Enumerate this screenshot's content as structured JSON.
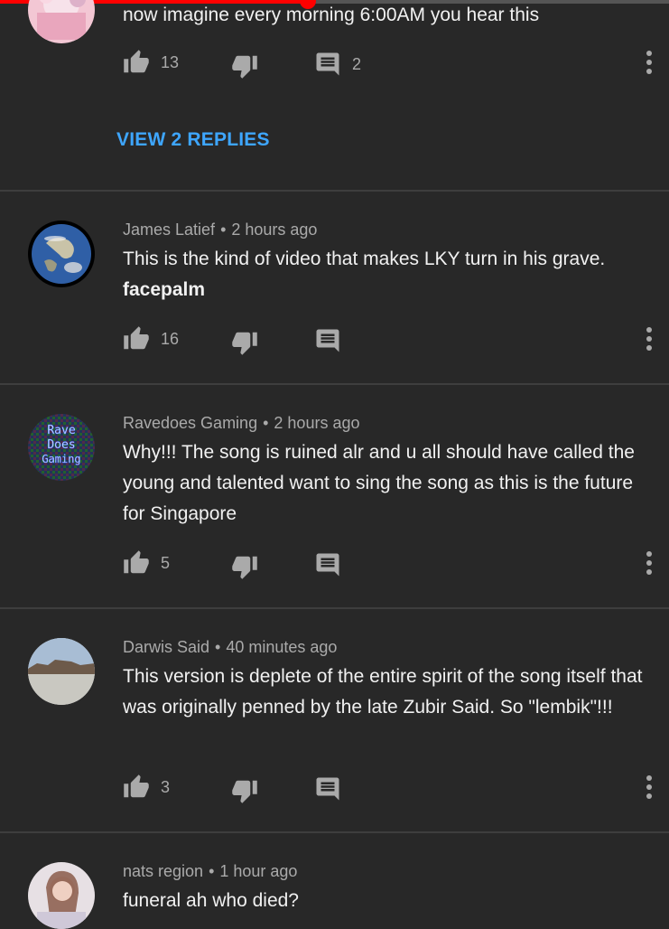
{
  "player": {
    "progress_percent": 46
  },
  "comments": [
    {
      "author": "",
      "time": "",
      "text": "now imagine every morning 6:00AM you hear this",
      "likes": "13",
      "replies_count": "2",
      "view_replies": "VIEW 2 REPLIES"
    },
    {
      "author": "James Latief",
      "time": "2 hours ago",
      "text": "This is the kind of video that makes LKY turn in his grave.",
      "bold": "facepalm",
      "likes": "16"
    },
    {
      "author": "Ravedoes Gaming",
      "time": "2 hours ago",
      "text": "Why!!! The song is ruined alr and u all should have called the young and talented want to sing the song as this is the future for Singapore",
      "likes": "5",
      "avatar_text": [
        "Rave",
        "Does",
        "Gaming"
      ]
    },
    {
      "author": "Darwis Said",
      "time": "40 minutes ago",
      "text": "This version is deplete of the entire spirit of the song itself that was originally penned by the late Zubir Said. So \"lembik\"!!!",
      "likes": "3"
    },
    {
      "author": "nats region",
      "time": "1 hour ago",
      "text": "funeral ah who died?"
    }
  ],
  "colors": {
    "background": "#282828",
    "link": "#3ea6ff",
    "divider": "#3e3e3e",
    "progress": "#ff0000"
  }
}
